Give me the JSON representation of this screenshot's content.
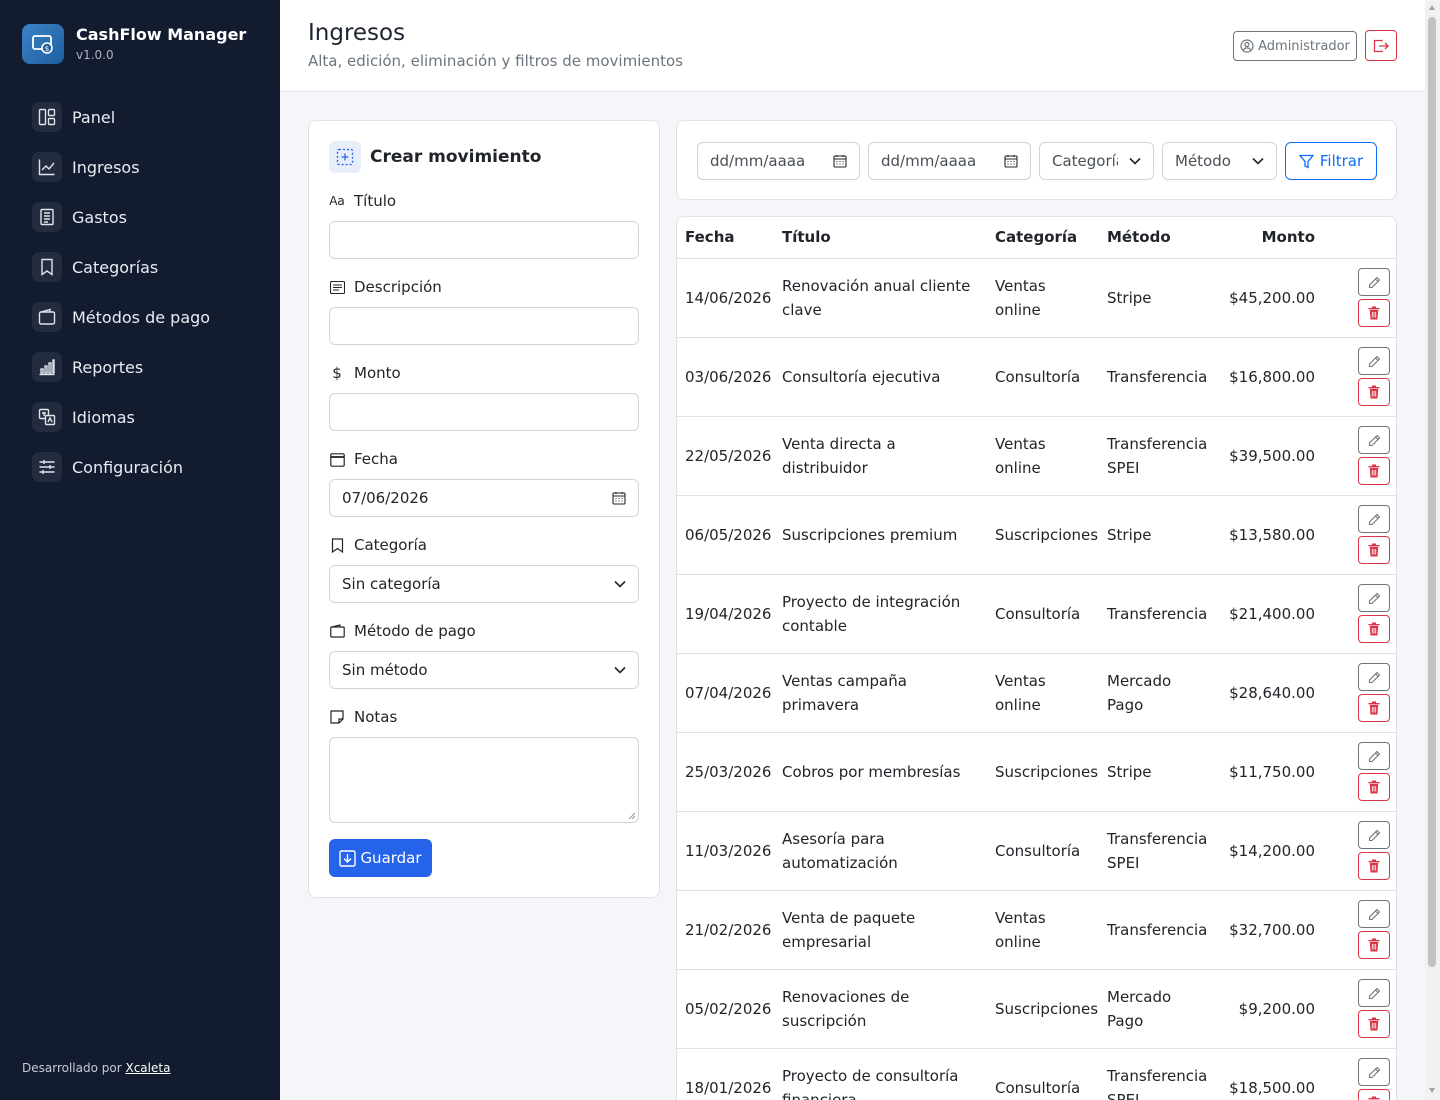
{
  "app": {
    "name": "CashFlow Manager",
    "version": "v1.0.0"
  },
  "sidebar": {
    "items": [
      {
        "label": "Panel",
        "icon": "dashboard-icon"
      },
      {
        "label": "Ingresos",
        "icon": "trend-up-icon"
      },
      {
        "label": "Gastos",
        "icon": "receipt-icon"
      },
      {
        "label": "Categorías",
        "icon": "bookmark-icon"
      },
      {
        "label": "Métodos de pago",
        "icon": "wallet-icon"
      },
      {
        "label": "Reportes",
        "icon": "bar-chart-icon"
      },
      {
        "label": "Idiomas",
        "icon": "translate-icon"
      },
      {
        "label": "Configuración",
        "icon": "sliders-icon"
      }
    ],
    "footer_prefix": "Desarrollado por",
    "footer_link": "Xcaleta"
  },
  "header": {
    "title": "Ingresos",
    "subtitle": "Alta, edición, eliminación y filtros de movimientos",
    "user_label": "Administrador"
  },
  "form": {
    "title": "Crear movimiento",
    "title_label": "Título",
    "description_label": "Descripción",
    "amount_label": "Monto",
    "date_label": "Fecha",
    "date_value": "07/06/2026",
    "category_label": "Categoría",
    "category_value": "Sin categoría",
    "method_label": "Método de pago",
    "method_value": "Sin método",
    "notes_label": "Notas",
    "save_label": "Guardar"
  },
  "filters": {
    "date_from_placeholder": "dd/mm/aaaa",
    "date_to_placeholder": "dd/mm/aaaa",
    "category": "Categoría",
    "method": "Método",
    "filter_label": "Filtrar"
  },
  "table": {
    "headers": {
      "date": "Fecha",
      "title": "Título",
      "category": "Categoría",
      "method": "Método",
      "amount": "Monto"
    },
    "rows": [
      {
        "date": "14/06/2026",
        "title": "Renovación anual cliente clave",
        "category": "Ventas online",
        "method": "Stripe",
        "amount": "$45,200.00"
      },
      {
        "date": "03/06/2026",
        "title": "Consultoría ejecutiva",
        "category": "Consultoría",
        "method": "Transferencia",
        "amount": "$16,800.00"
      },
      {
        "date": "22/05/2026",
        "title": "Venta directa a distribuidor",
        "category": "Ventas online",
        "method": "Transferencia SPEI",
        "amount": "$39,500.00"
      },
      {
        "date": "06/05/2026",
        "title": "Suscripciones premium",
        "category": "Suscripciones",
        "method": "Stripe",
        "amount": "$13,580.00"
      },
      {
        "date": "19/04/2026",
        "title": "Proyecto de integración contable",
        "category": "Consultoría",
        "method": "Transferencia",
        "amount": "$21,400.00"
      },
      {
        "date": "07/04/2026",
        "title": "Ventas campaña primavera",
        "category": "Ventas online",
        "method": "Mercado Pago",
        "amount": "$28,640.00"
      },
      {
        "date": "25/03/2026",
        "title": "Cobros por membresías",
        "category": "Suscripciones",
        "method": "Stripe",
        "amount": "$11,750.00"
      },
      {
        "date": "11/03/2026",
        "title": "Asesoría para automatización",
        "category": "Consultoría",
        "method": "Transferencia SPEI",
        "amount": "$14,200.00"
      },
      {
        "date": "21/02/2026",
        "title": "Venta de paquete empresarial",
        "category": "Ventas online",
        "method": "Transferencia",
        "amount": "$32,700.00"
      },
      {
        "date": "05/02/2026",
        "title": "Renovaciones de suscripción",
        "category": "Suscripciones",
        "method": "Mercado Pago",
        "amount": "$9,200.00"
      },
      {
        "date": "18/01/2026",
        "title": "Proyecto de consultoría financiera",
        "category": "Consultoría",
        "method": "Transferencia SPEI",
        "amount": "$18,500.00"
      }
    ]
  }
}
